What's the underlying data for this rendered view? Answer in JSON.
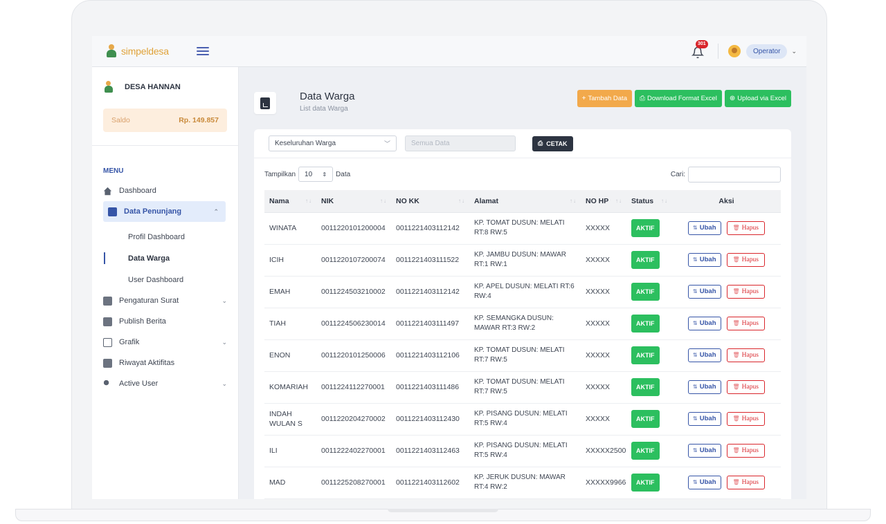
{
  "brand": {
    "name": "simpeldesa"
  },
  "topbar": {
    "notification_count": "301",
    "user_label": "Operator",
    "caret": "⌄"
  },
  "sidebar": {
    "village_name": "DESA HANNAN",
    "saldo_label": "Saldo",
    "saldo_value": "Rp. 149.857",
    "menu_title": "MENU",
    "items": [
      {
        "label": "Dashboard",
        "icon": "home-icon"
      },
      {
        "label": "Data Penunjang",
        "icon": "document-icon",
        "chevron": "⌃"
      },
      {
        "label": "Pengaturan Surat",
        "icon": "mail-settings-icon",
        "chevron": "⌄"
      },
      {
        "label": "Publish Berita",
        "icon": "newspaper-icon"
      },
      {
        "label": "Grafik",
        "icon": "chart-icon",
        "chevron": "⌄"
      },
      {
        "label": "Riwayat Aktifitas",
        "icon": "history-icon"
      },
      {
        "label": "Active User",
        "icon": "users-icon",
        "chevron": "⌄"
      }
    ],
    "sub_items": [
      {
        "label": "Profil Dashboard"
      },
      {
        "label": "Data Warga"
      },
      {
        "label": "User Dashboard"
      }
    ]
  },
  "page": {
    "title": "Data Warga",
    "subtitle": "List data Warga",
    "buttons": {
      "add": "Tambah Data",
      "download": "Download Format Excel",
      "upload": "Upload via Excel"
    }
  },
  "filters": {
    "scope_value": "Keseluruhan Warga",
    "data_placeholder": "Semua Data",
    "print_label": "CETAK"
  },
  "list": {
    "show_label": "Tampilkan",
    "show_value": "10",
    "show_suffix": "Data",
    "search_label": "Cari:"
  },
  "table": {
    "headers": [
      "Nama",
      "NIK",
      "NO KK",
      "Alamat",
      "NO HP",
      "Status",
      "Aksi"
    ],
    "edit_label": "Ubah",
    "delete_label": "Hapus",
    "rows": [
      {
        "nama": "WINATA",
        "nik": "0011220101200004",
        "kk": "0011221403112142",
        "alamat": "KP. TOMAT DUSUN: MELATI RT:8 RW:5",
        "hp": "XXXXX",
        "status": "AKTIF"
      },
      {
        "nama": "ICIH",
        "nik": "0011220107200074",
        "kk": "0011221403111522",
        "alamat": "KP. JAMBU DUSUN: MAWAR RT:1 RW:1",
        "hp": "XXXXX",
        "status": "AKTIF"
      },
      {
        "nama": "EMAH",
        "nik": "0011224503210002",
        "kk": "0011221403112142",
        "alamat": "KP. APEL DUSUN: MELATI RT:6 RW:4",
        "hp": "XXXXX",
        "status": "AKTIF"
      },
      {
        "nama": "TIAH",
        "nik": "0011224506230014",
        "kk": "0011221403111497",
        "alamat": "KP. SEMANGKA DUSUN: MAWAR RT:3 RW:2",
        "hp": "XXXXX",
        "status": "AKTIF"
      },
      {
        "nama": "ENON",
        "nik": "0011220101250006",
        "kk": "0011221403112106",
        "alamat": "KP. TOMAT DUSUN: MELATI RT:7 RW:5",
        "hp": "XXXXX",
        "status": "AKTIF"
      },
      {
        "nama": "KOMARIAH",
        "nik": "0011224112270001",
        "kk": "0011221403111486",
        "alamat": "KP. TOMAT DUSUN: MELATI RT:7 RW:5",
        "hp": "XXXXX",
        "status": "AKTIF"
      },
      {
        "nama": "INDAH WULAN S",
        "nik": "0011220204270002",
        "kk": "0011221403112430",
        "alamat": "KP. PISANG DUSUN: MELATI RT:5 RW:4",
        "hp": "XXXXX",
        "status": "AKTIF"
      },
      {
        "nama": "ILI",
        "nik": "0011222402270001",
        "kk": "0011221403112463",
        "alamat": "KP. PISANG DUSUN: MELATI RT:5 RW:4",
        "hp": "XXXXX2500",
        "status": "AKTIF"
      },
      {
        "nama": "MAD",
        "nik": "0011225208270001",
        "kk": "0011221403112602",
        "alamat": "KP. JERUK DUSUN: MAWAR RT:4 RW:2",
        "hp": "XXXXX9966",
        "status": "AKTIF"
      }
    ]
  },
  "colors": {
    "accent": "#3655a7",
    "success": "#2cbf5f",
    "warning": "#f2a94b",
    "danger": "#d9252b"
  }
}
